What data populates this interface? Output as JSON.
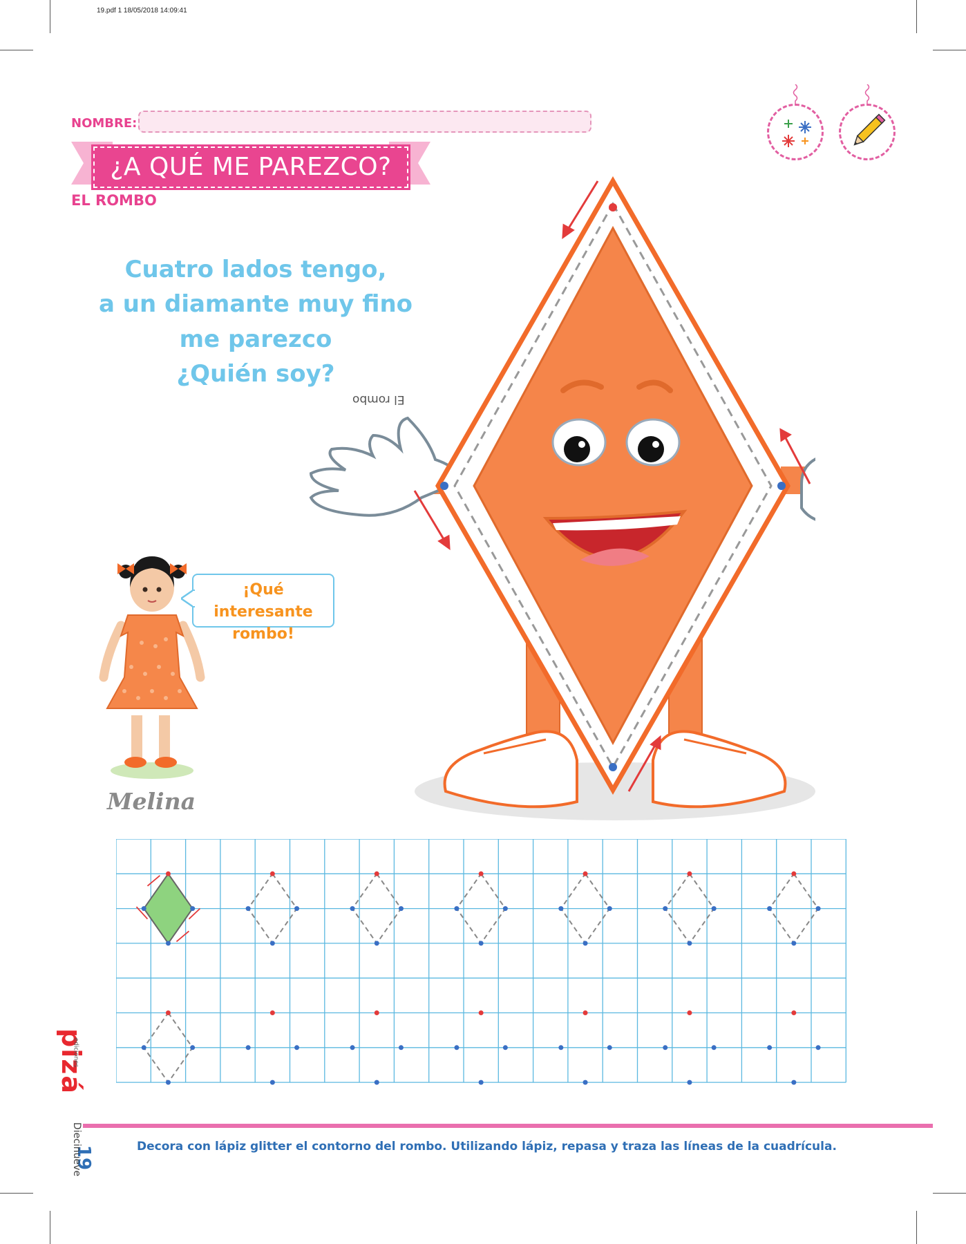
{
  "header": {
    "print_info": "19.pdf  1  18/05/2018  14:09:41",
    "name_label": "NOMBRE:",
    "title": "¿A QUÉ ME PAREZCO?",
    "subtitle": "EL ROMBO"
  },
  "badges": [
    {
      "icon": "sparkles-icon"
    },
    {
      "icon": "pencil-icon"
    }
  ],
  "riddle": {
    "lines": [
      "Cuatro lados tengo,",
      "a un diamante muy fino",
      "me parezco",
      "¿Quién soy?"
    ],
    "answer_upside_down": "El rombo"
  },
  "girl": {
    "speech": [
      "¡Qué interesante",
      "rombo!"
    ],
    "name": "Melina"
  },
  "sidebar": {
    "brand": "pizá",
    "brand_sub": "ediciones",
    "page_number": "19",
    "page_word": "Diecinueve"
  },
  "instructions": "Decora con lápiz glitter el contorno del rombo. Utilizando lápiz, repasa y traza las líneas de la cuadrícula.",
  "colors": {
    "pink": "#e94590",
    "sky_blue": "#6fc6ea",
    "orange": "#f5854a",
    "grid_blue": "#5bb8e0",
    "dot_red": "#e33b3b",
    "dot_blue": "#3a6fc4",
    "green_fill": "#8ed37f"
  }
}
